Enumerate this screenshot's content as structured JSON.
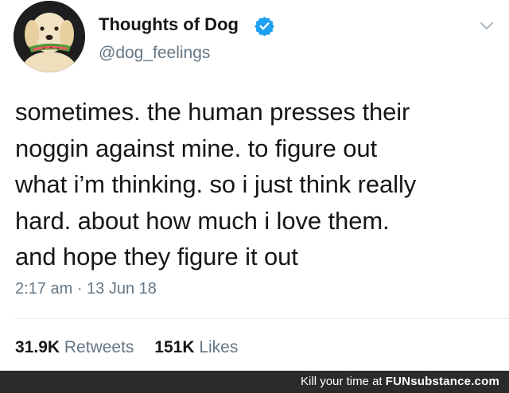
{
  "tweet": {
    "display_name": "Thoughts of Dog",
    "handle": "@dog_feelings",
    "text_lines": [
      "sometimes. the human presses their",
      "noggin against mine. to figure out",
      "what i’m thinking. so i just think really",
      "hard. about how much i love them.",
      "and hope they figure it out"
    ],
    "timestamp": "2:17 am · 13 Jun 18",
    "retweets_count": "31.9K",
    "retweets_label": "Retweets",
    "likes_count": "151K",
    "likes_label": "Likes"
  },
  "icons": {
    "verified": "verified-badge-icon",
    "caret": "chevron-down-icon",
    "avatar": "dog-avatar"
  },
  "colors": {
    "verified_blue": "#1da1f2",
    "secondary_text": "#657786",
    "primary_text": "#14171a",
    "footer_bg": "#2b2b2b"
  },
  "watermark": {
    "prefix": "Kill your time at",
    "brand": "FUNsubstance.com"
  }
}
